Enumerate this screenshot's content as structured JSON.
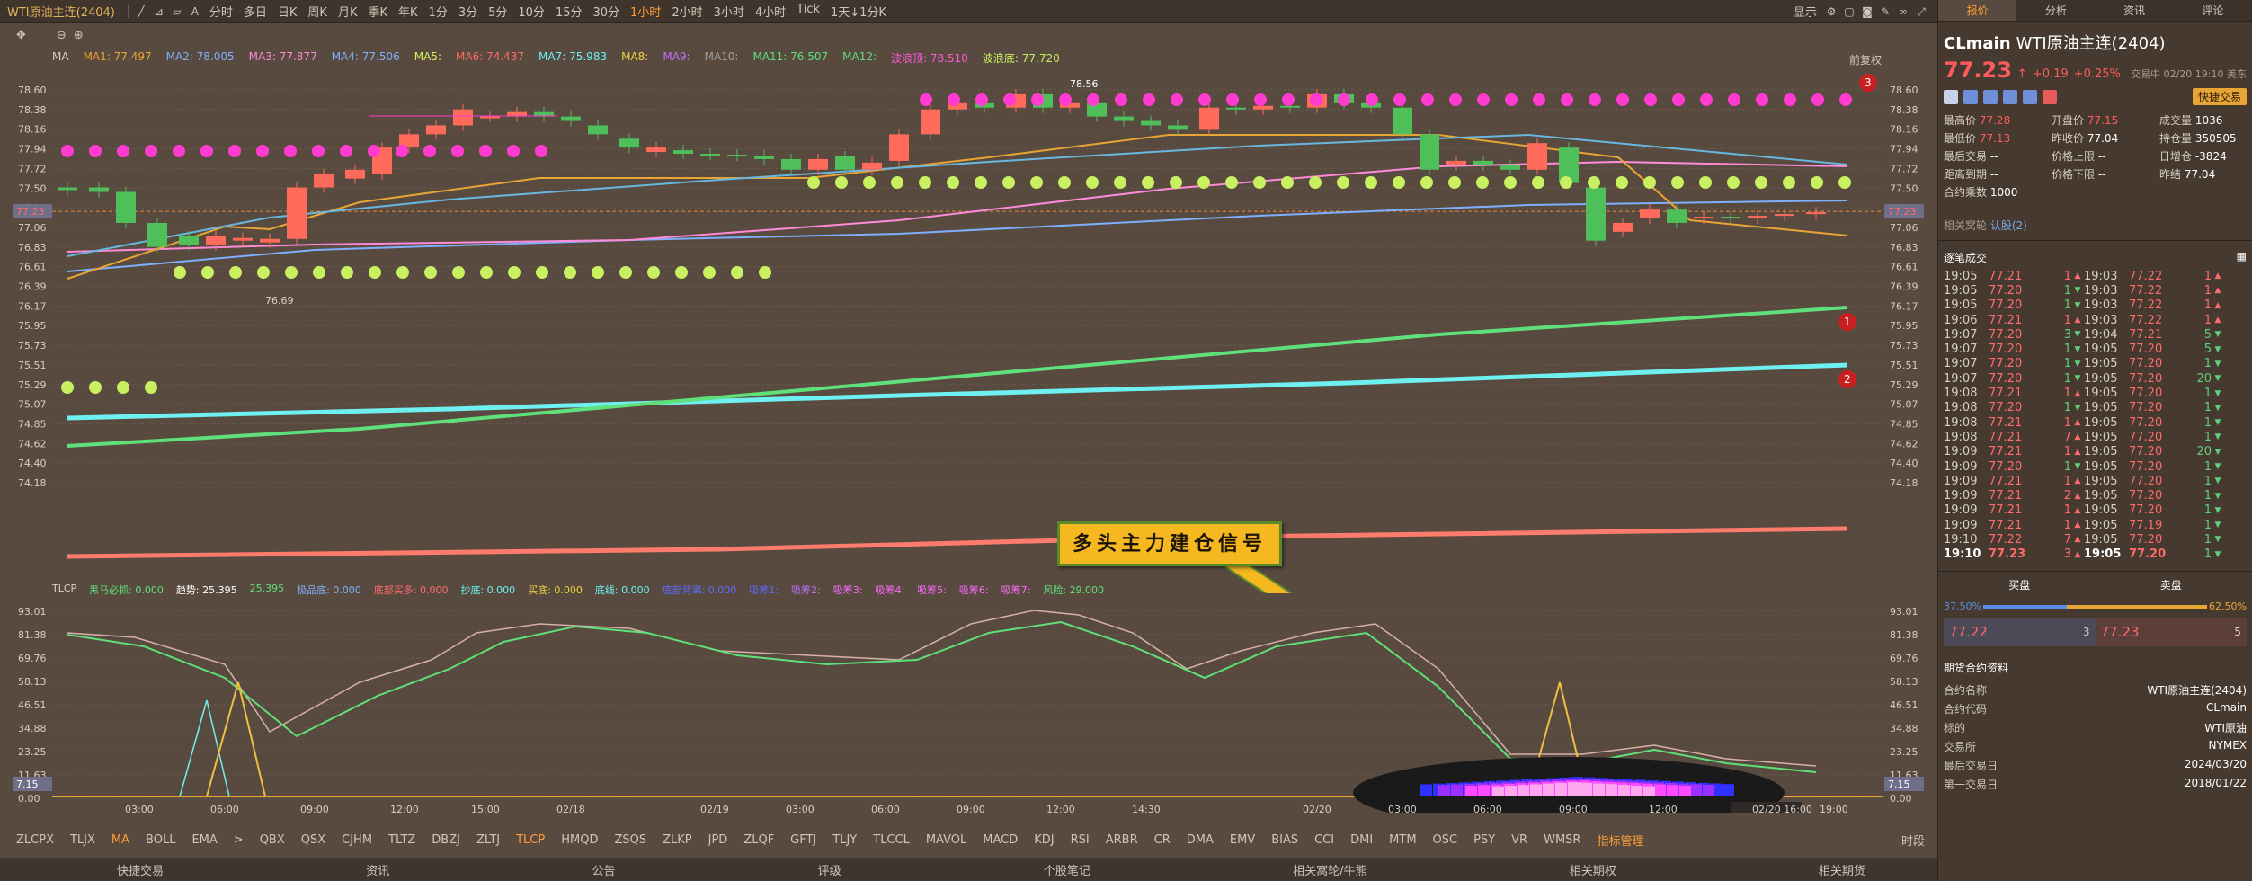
{
  "topbar": {
    "title": "WTI原油主连(2404)",
    "intervals": [
      "分时",
      "多日",
      "日K",
      "周K",
      "月K",
      "季K",
      "年K",
      "1分",
      "3分",
      "5分",
      "10分",
      "15分",
      "30分",
      "1小时",
      "2小时",
      "3小时",
      "4小时",
      "Tick",
      "1天↓1分K"
    ],
    "active_interval": "1小时",
    "display_label": "显示"
  },
  "main_legend": [
    {
      "label": "MA",
      "color": "#d8cfc4"
    },
    {
      "label": "MA1: 77.497",
      "color": "#e9a436"
    },
    {
      "label": "MA2: 78.005",
      "color": "#7fb0ff"
    },
    {
      "label": "MA3: 77.877",
      "color": "#ff8ad8"
    },
    {
      "label": "MA4: 77.506",
      "color": "#7fb0ff"
    },
    {
      "label": "MA5:",
      "color": "#d8f060"
    },
    {
      "label": "MA6: 74.437",
      "color": "#ff6b6b"
    },
    {
      "label": "MA7: 75.983",
      "color": "#6ef0f0"
    },
    {
      "label": "MA8:",
      "color": "#f0d040"
    },
    {
      "label": "MA9:",
      "color": "#c070ff"
    },
    {
      "label": "MA10:",
      "color": "#a0a0a0"
    },
    {
      "label": "MA11: 76.507",
      "color": "#5fe07a"
    },
    {
      "label": "MA12:",
      "color": "#5fe07a"
    },
    {
      "label": "波浪顶: 78.510",
      "color": "#ff5bd8"
    },
    {
      "label": "波浪底: 77.720",
      "color": "#c8f060"
    }
  ],
  "restore_label": "前复权",
  "y_axis": [
    "78.60",
    "78.38",
    "78.16",
    "77.94",
    "77.72",
    "77.50",
    "77.28",
    "77.06",
    "76.83",
    "76.61",
    "76.39",
    "76.17",
    "75.95",
    "75.73",
    "75.51",
    "75.29",
    "75.07",
    "74.85",
    "74.62",
    "74.40",
    "74.18"
  ],
  "current_price_tag": "77.23",
  "high_label": "78.56",
  "low_label": "76.69",
  "markers": [
    "1",
    "2",
    "3"
  ],
  "signal_text": "多头主力建仓信号",
  "sub_legend": [
    {
      "label": "TLCP",
      "color": "#d8cfc4"
    },
    {
      "label": "黑马必抓: 0.000",
      "color": "#5fe07a"
    },
    {
      "label": "趋势: 25.395",
      "color": "#ffffff"
    },
    {
      "label": "25.395",
      "color": "#5fe07a"
    },
    {
      "label": "极品底: 0.000",
      "color": "#7fb0ff"
    },
    {
      "label": "底部买多: 0.000",
      "color": "#ff6b6b"
    },
    {
      "label": "抄底: 0.000",
      "color": "#6ef0f0"
    },
    {
      "label": "买底: 0.000",
      "color": "#f0d040"
    },
    {
      "label": "底线: 0.000",
      "color": "#6ef0f0"
    },
    {
      "label": "底部背离: 0.000",
      "color": "#5b6bff"
    },
    {
      "label": "吸筹1:",
      "color": "#5b6bff"
    },
    {
      "label": "吸筹2:",
      "color": "#c070ff"
    },
    {
      "label": "吸筹3:",
      "color": "#ff6bff"
    },
    {
      "label": "吸筹4:",
      "color": "#ff6bff"
    },
    {
      "label": "吸筹5:",
      "color": "#ff6bff"
    },
    {
      "label": "吸筹6:",
      "color": "#ff6bff"
    },
    {
      "label": "吸筹7:",
      "color": "#ff6bff"
    },
    {
      "label": "风险: 29.000",
      "color": "#5fe07a"
    }
  ],
  "sub_y_axis": [
    "93.01",
    "81.38",
    "69.76",
    "58.13",
    "46.51",
    "34.88",
    "23.25",
    "11.63",
    "0.00"
  ],
  "sub_current_tag": "7.15",
  "x_axis": [
    "03:00",
    "06:00",
    "09:00",
    "12:00",
    "15:00",
    "02/18",
    "02/19",
    "03:00",
    "06:00",
    "09:00",
    "12:00",
    "14:30",
    "02/20",
    "03:00",
    "06:00",
    "09:00",
    "12:00",
    "02/20 16:00",
    "19:00"
  ],
  "indicator_tabs": [
    "ZLCPX",
    "TLJX",
    "MA",
    "BOLL",
    "EMA",
    ">",
    "QBX",
    "QSX",
    "CJHM",
    "TLTZ",
    "DBZJ",
    "ZLTJ",
    "TLCP",
    "HMQD",
    "ZSQS",
    "ZLKP",
    "JPD",
    "ZLQF",
    "GFTJ",
    "TLJY",
    "TLCCL",
    "MAVOL",
    "MACD",
    "KDJ",
    "RSI",
    "ARBR",
    "CR",
    "DMA",
    "EMV",
    "BIAS",
    "CCI",
    "DMI",
    "MTM",
    "OSC",
    "PSY",
    "VR",
    "WMSR",
    "指标管理"
  ],
  "indicator_active": [
    "MA",
    "TLCP",
    "指标管理"
  ],
  "indicator_right": "时段",
  "bottom_links": [
    "快捷交易",
    "资讯",
    "公告",
    "评级",
    "个股笔记",
    "相关窝轮/牛熊",
    "相关期权",
    "相关期货"
  ],
  "right_panel": {
    "tabs": [
      "报价",
      "分析",
      "资讯",
      "评论"
    ],
    "active_tab": "报价",
    "code": "CLmain",
    "name": "WTI原油主连(2404)",
    "price": "77.23",
    "arrow": "↑",
    "change": "+0.19",
    "change_pct": "+0.25%",
    "status": "交易中 02/20 19:10 美东",
    "quick_trade": "快捷交易",
    "stats": [
      {
        "k": "最高价",
        "v": "77.28",
        "c": "r"
      },
      {
        "k": "开盘价",
        "v": "77.15",
        "c": "r"
      },
      {
        "k": "成交量",
        "v": "1036",
        "c": "v"
      },
      {
        "k": "最低价",
        "v": "77.13",
        "c": "r"
      },
      {
        "k": "昨收价",
        "v": "77.04",
        "c": "v"
      },
      {
        "k": "持仓量",
        "v": "350505",
        "c": "v"
      },
      {
        "k": "最后交易",
        "v": "--",
        "c": "v"
      },
      {
        "k": "价格上限",
        "v": "--",
        "c": "v"
      },
      {
        "k": "日增仓",
        "v": "-3824",
        "c": "v"
      },
      {
        "k": "距离到期",
        "v": "--",
        "c": "v"
      },
      {
        "k": "价格下限",
        "v": "--",
        "c": "v"
      },
      {
        "k": "昨结",
        "v": "77.04",
        "c": "v"
      },
      {
        "k": "合约乘数",
        "v": "1000",
        "c": "v"
      }
    ],
    "related_label": "相关窝轮",
    "related_link": "认股(2)",
    "trades_title": "逐笔成交",
    "trades": [
      [
        "19:05",
        "77.21",
        "1",
        "up",
        "19:03",
        "77.22",
        "1",
        "up"
      ],
      [
        "19:05",
        "77.20",
        "1",
        "dn",
        "19:03",
        "77.22",
        "1",
        "up"
      ],
      [
        "19:05",
        "77.20",
        "1",
        "dn",
        "19:03",
        "77.22",
        "1",
        "up"
      ],
      [
        "19:06",
        "77.21",
        "1",
        "up",
        "19:03",
        "77.22",
        "1",
        "up"
      ],
      [
        "19:07",
        "77.20",
        "3",
        "dn",
        "19:04",
        "77.21",
        "5",
        "dn"
      ],
      [
        "19:07",
        "77.20",
        "1",
        "dn",
        "19:05",
        "77.20",
        "5",
        "dn"
      ],
      [
        "19:07",
        "77.20",
        "1",
        "dn",
        "19:05",
        "77.20",
        "1",
        "dn"
      ],
      [
        "19:07",
        "77.20",
        "1",
        "dn",
        "19:05",
        "77.20",
        "20",
        "dn"
      ],
      [
        "19:08",
        "77.21",
        "1",
        "up",
        "19:05",
        "77.20",
        "1",
        "dn"
      ],
      [
        "19:08",
        "77.20",
        "1",
        "dn",
        "19:05",
        "77.20",
        "1",
        "dn"
      ],
      [
        "19:08",
        "77.21",
        "1",
        "up",
        "19:05",
        "77.20",
        "1",
        "dn"
      ],
      [
        "19:08",
        "77.21",
        "7",
        "up",
        "19:05",
        "77.20",
        "1",
        "dn"
      ],
      [
        "19:09",
        "77.21",
        "1",
        "up",
        "19:05",
        "77.20",
        "20",
        "dn"
      ],
      [
        "19:09",
        "77.20",
        "1",
        "dn",
        "19:05",
        "77.20",
        "1",
        "dn"
      ],
      [
        "19:09",
        "77.21",
        "1",
        "up",
        "19:05",
        "77.20",
        "1",
        "dn"
      ],
      [
        "19:09",
        "77.21",
        "2",
        "up",
        "19:05",
        "77.20",
        "1",
        "dn"
      ],
      [
        "19:09",
        "77.21",
        "1",
        "up",
        "19:05",
        "77.20",
        "1",
        "dn"
      ],
      [
        "19:09",
        "77.21",
        "1",
        "up",
        "19:05",
        "77.19",
        "1",
        "dn"
      ],
      [
        "19:10",
        "77.22",
        "7",
        "up",
        "19:05",
        "77.20",
        "1",
        "dn"
      ],
      [
        "19:10",
        "77.23",
        "3",
        "up",
        "19:05",
        "77.20",
        "1",
        "dn"
      ]
    ],
    "book": {
      "buy_label": "买盘",
      "sell_label": "卖盘",
      "buy_pct": "37.50%",
      "sell_pct": "62.50%",
      "buy_ratio": 0.375,
      "bid": "77.22",
      "bid_qty": "3",
      "ask": "77.23",
      "ask_qty": "5"
    },
    "info_title": "期货合约资料",
    "info": [
      {
        "k": "合约名称",
        "v": "WTI原油主连(2404)"
      },
      {
        "k": "合约代码",
        "v": "CLmain"
      },
      {
        "k": "标的",
        "v": "WTI原油"
      },
      {
        "k": "交易所",
        "v": "NYMEX"
      },
      {
        "k": "最后交易日",
        "v": "2024/03/20"
      },
      {
        "k": "第一交易日",
        "v": "2018/01/22"
      }
    ]
  }
}
